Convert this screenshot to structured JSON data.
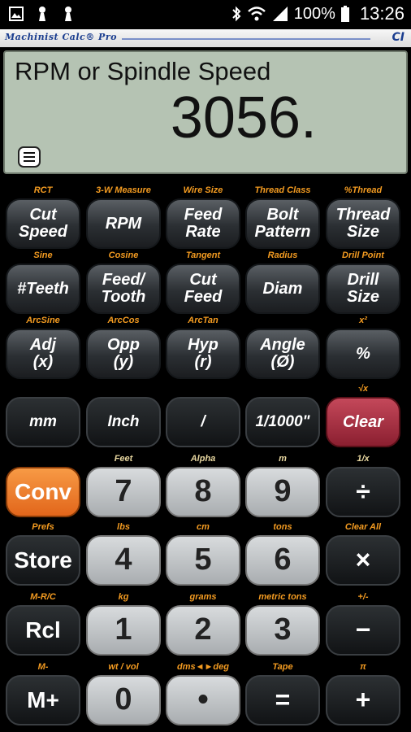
{
  "status": {
    "battery": "100%",
    "time": "13:26"
  },
  "app": {
    "title": "Machinist Calc® Pro",
    "logo": "CI"
  },
  "display": {
    "label": "RPM or Spindle Speed",
    "value": "3056."
  },
  "keys": [
    {
      "sub": "RCT",
      "label": "Cut\nSpeed"
    },
    {
      "sub": "3-W Measure",
      "label": "RPM"
    },
    {
      "sub": "Wire Size",
      "label": "Feed\nRate"
    },
    {
      "sub": "Thread Class",
      "label": "Bolt\nPattern"
    },
    {
      "sub": "%Thread",
      "label": "Thread\nSize"
    },
    {
      "sub": "Sine",
      "label": "#Teeth"
    },
    {
      "sub": "Cosine",
      "label": "Feed/\nTooth"
    },
    {
      "sub": "Tangent",
      "label": "Cut\nFeed"
    },
    {
      "sub": "Radius",
      "label": "Diam"
    },
    {
      "sub": "Drill Point",
      "label": "Drill\nSize"
    },
    {
      "sub": "ArcSine",
      "label": "Adj\n(x)"
    },
    {
      "sub": "ArcCos",
      "label": "Opp\n(y)"
    },
    {
      "sub": "ArcTan",
      "label": "Hyp\n(r)"
    },
    {
      "sub": "",
      "label": "Angle\n(Ø)"
    },
    {
      "sub": "x²",
      "label": "%"
    },
    {
      "sub": "",
      "label": "mm"
    },
    {
      "sub": "",
      "label": "Inch"
    },
    {
      "sub": "",
      "label": "/"
    },
    {
      "sub": "",
      "label": "1/1000\""
    },
    {
      "sub": "√x",
      "label": "Clear"
    },
    {
      "sub": "",
      "label": "Conv"
    },
    {
      "sub": "Feet",
      "label": "7"
    },
    {
      "sub": "Alpha",
      "label": "8"
    },
    {
      "sub": "m",
      "label": "9"
    },
    {
      "sub": "1/x",
      "label": "÷"
    },
    {
      "sub": "Prefs",
      "label": "Store"
    },
    {
      "sub": "lbs",
      "label": "4"
    },
    {
      "sub": "cm",
      "label": "5"
    },
    {
      "sub": "tons",
      "label": "6"
    },
    {
      "sub": "Clear All",
      "label": "×"
    },
    {
      "sub": "M-R/C",
      "label": "Rcl"
    },
    {
      "sub": "kg",
      "label": "1"
    },
    {
      "sub": "grams",
      "label": "2"
    },
    {
      "sub": "metric tons",
      "label": "3"
    },
    {
      "sub": "+/-",
      "label": "−"
    },
    {
      "sub": "M-",
      "label": "M+"
    },
    {
      "sub": "wt / vol",
      "label": "0"
    },
    {
      "sub": "dms◄►deg",
      "label": "•"
    },
    {
      "sub": "Tape",
      "label": "="
    },
    {
      "sub": "π",
      "label": "+"
    }
  ]
}
